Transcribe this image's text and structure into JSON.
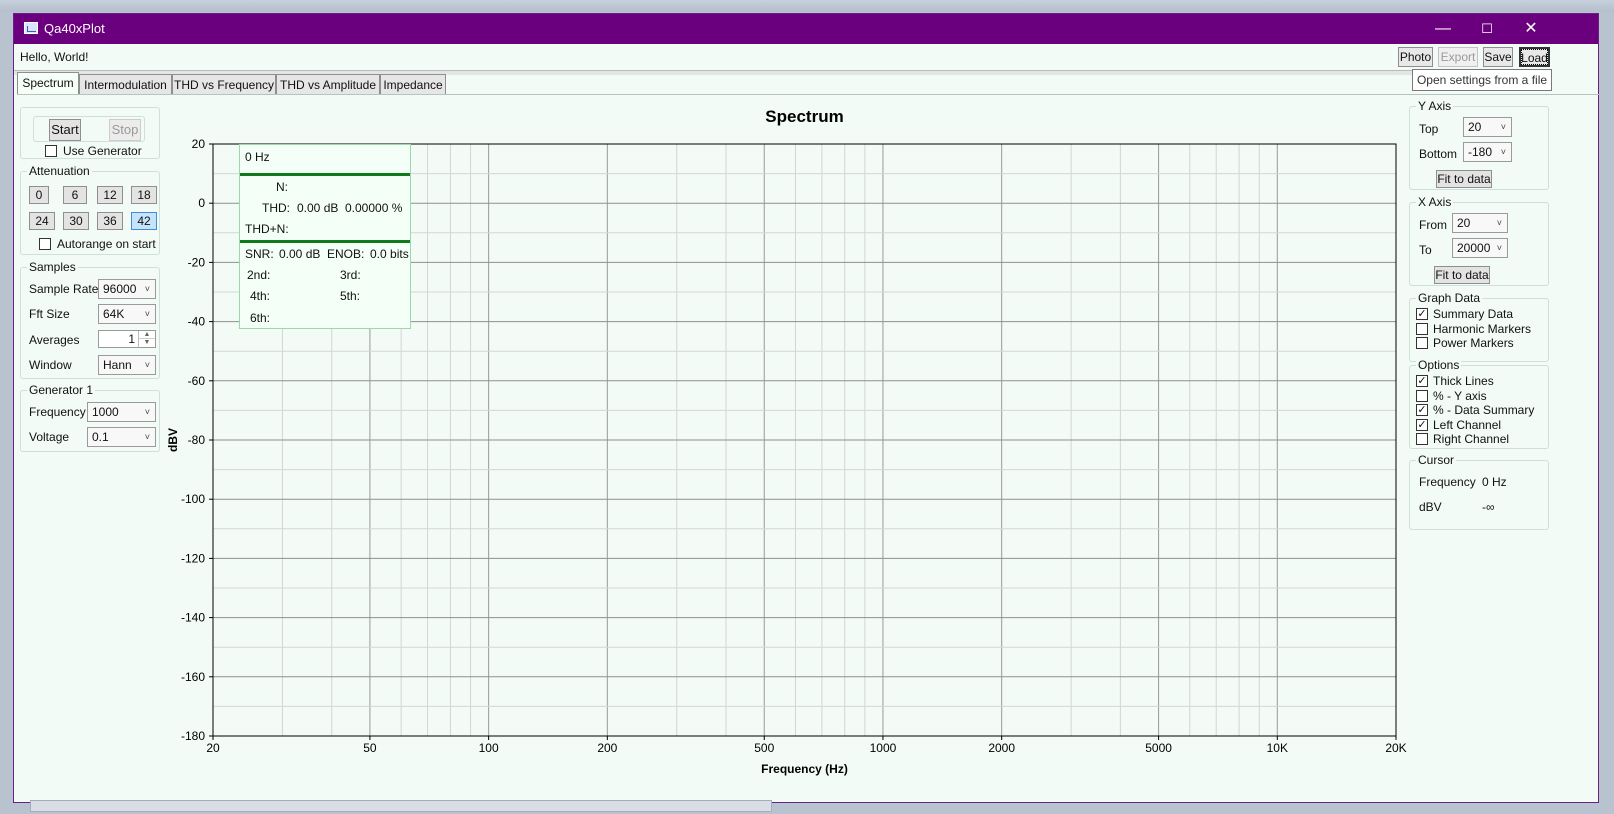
{
  "window": {
    "title": "Qa40xPlot",
    "minimize_icon": "—",
    "maximize_icon": "☐",
    "close_icon": "✕"
  },
  "status": {
    "message": "Hello, World!"
  },
  "toolbar": {
    "photo": "Photo",
    "export": "Export",
    "save": "Save",
    "load": "Load",
    "tooltip": "Open settings from a file"
  },
  "tabs": [
    {
      "label": "Spectrum"
    },
    {
      "label": "Intermodulation"
    },
    {
      "label": "THD vs Frequency"
    },
    {
      "label": "THD vs Amplitude"
    },
    {
      "label": "Impedance"
    }
  ],
  "run": {
    "start": "Start",
    "stop": "Stop",
    "use_generator": "Use Generator"
  },
  "attenuation": {
    "title": "Attenuation",
    "values": [
      "0",
      "6",
      "12",
      "18",
      "24",
      "30",
      "36",
      "42"
    ],
    "selected": "42",
    "autorange": "Autorange on start"
  },
  "samples": {
    "title": "Samples",
    "sample_rate_label": "Sample Rate",
    "sample_rate": "96000",
    "fft_size_label": "Fft Size",
    "fft_size": "64K",
    "averages_label": "Averages",
    "averages": "1",
    "window_label": "Window",
    "window": "Hann"
  },
  "generator": {
    "title": "Generator 1",
    "frequency_label": "Frequency",
    "frequency": "1000",
    "voltage_label": "Voltage",
    "voltage": "0.1"
  },
  "summary": {
    "freq": "0 Hz",
    "n_label": "N:",
    "thd_label": "THD:",
    "thd_db": "0.00 dB",
    "thd_pct": "0.00000 %",
    "thdn_label": "THD+N:",
    "snr_label": "SNR:",
    "snr": "0.00 dB",
    "enob_label": "ENOB:",
    "enob": "0.0 bits",
    "h2": "2nd:",
    "h3": "3rd:",
    "h4": "4th:",
    "h5": "5th:",
    "h6": "6th:"
  },
  "yaxis_panel": {
    "title": "Y Axis",
    "top_label": "Top",
    "top": "20",
    "bottom_label": "Bottom",
    "bottom": "-180",
    "fit": "Fit to data"
  },
  "xaxis_panel": {
    "title": "X Axis",
    "from_label": "From",
    "from": "20",
    "to_label": "To",
    "to": "20000",
    "fit": "Fit to data"
  },
  "graph_data": {
    "title": "Graph Data",
    "items": [
      {
        "label": "Summary Data",
        "checked": true
      },
      {
        "label": "Harmonic Markers",
        "checked": false
      },
      {
        "label": "Power Markers",
        "checked": false
      }
    ]
  },
  "options": {
    "title": "Options",
    "items": [
      {
        "label": "Thick Lines",
        "checked": true
      },
      {
        "label": "% - Y axis",
        "checked": false
      },
      {
        "label": "% - Data Summary",
        "checked": true
      },
      {
        "label": "Left Channel",
        "checked": true
      },
      {
        "label": "Right Channel",
        "checked": false
      }
    ]
  },
  "cursor": {
    "title": "Cursor",
    "frequency_label": "Frequency",
    "frequency": "0 Hz",
    "dbv_label": "dBV",
    "dbv": "-∞"
  },
  "check_glyph": "✓",
  "combo_arrow": "˅",
  "spin_up": "▲",
  "spin_down": "▼",
  "chart_data": {
    "type": "line",
    "title": "Spectrum",
    "xlabel": "Frequency (Hz)",
    "ylabel": "dBV",
    "xscale": "log",
    "xlim": [
      20,
      20000
    ],
    "ylim": [
      -180,
      20
    ],
    "x_ticks": [
      {
        "value": 20,
        "label": "20"
      },
      {
        "value": 50,
        "label": "50"
      },
      {
        "value": 100,
        "label": "100"
      },
      {
        "value": 200,
        "label": "200"
      },
      {
        "value": 500,
        "label": "500"
      },
      {
        "value": 1000,
        "label": "1000"
      },
      {
        "value": 2000,
        "label": "2000"
      },
      {
        "value": 5000,
        "label": "5000"
      },
      {
        "value": 10000,
        "label": "10K"
      },
      {
        "value": 20000,
        "label": "20K"
      }
    ],
    "y_ticks": [
      20,
      0,
      -20,
      -40,
      -60,
      -80,
      -100,
      -120,
      -140,
      -160,
      -180
    ],
    "grid": true,
    "series": []
  }
}
